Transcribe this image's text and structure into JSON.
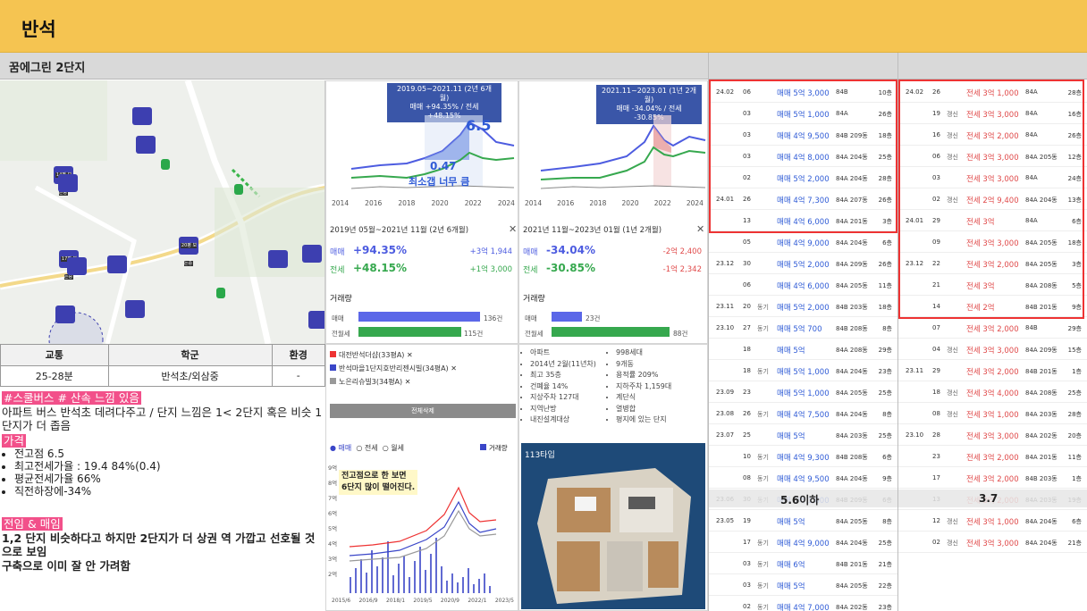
{
  "header": {
    "title": "반석"
  },
  "complex": {
    "name": "꿈에그린 2단지"
  },
  "map": {
    "labels": [
      "17평 보는중",
      "14평 보는중",
      "20평 보는중"
    ]
  },
  "chart_left": {
    "caption_line1": "2019.05~2021.11 (2년 6개월)",
    "caption_line2": "매매 +94.35% / 전세 +48.15%",
    "annotation_big": "6.5",
    "annotation_small": "0.47",
    "annotation_text": "최소갭 너무 큼",
    "summary_period": "2019년 05월~2021년 11월 (2년 6개월)",
    "sale_label": "매매",
    "sale_pct": "+94.35%",
    "sale_amt": "+3억 1,944",
    "rent_label": "전세",
    "rent_pct": "+48.15%",
    "rent_amt": "+1억 3,000",
    "volume_label": "거래량",
    "vol_sale_label": "매매",
    "vol_sale": "136건",
    "vol_rent_label": "전월세",
    "vol_rent": "115건",
    "x_ticks": [
      "2014",
      "2016",
      "2018",
      "2020",
      "2022",
      "2024"
    ]
  },
  "chart_right": {
    "caption_line1": "2021.11~2023.01 (1년 2개월)",
    "caption_line2": "매매 -34.04% / 전세 -30.85%",
    "summary_period": "2021년 11월~2023년 01월 (1년 2개월)",
    "sale_label": "매매",
    "sale_pct": "-34.04%",
    "sale_amt": "-2억 2,400",
    "rent_label": "전세",
    "rent_pct": "-30.85%",
    "rent_amt": "-1억 2,342",
    "volume_label": "거래량",
    "vol_sale_label": "매매",
    "vol_sale": "23건",
    "vol_rent_label": "전월세",
    "vol_rent": "88건",
    "x_ticks": [
      "2014",
      "2016",
      "2018",
      "2020",
      "2022",
      "2024"
    ]
  },
  "info_table": {
    "headers": [
      "교통",
      "학군",
      "환경"
    ],
    "values": [
      "25-28분",
      "반석초/외삼중",
      "-"
    ]
  },
  "notes": {
    "tag1": "#스쿨버스 # 산속 느낌 있음",
    "line1": "아파트 버스 반석초 데려다주고 / 단지 느낌은 1< 2단지 혹은 비슷 1단지가 더 좁음",
    "tag2": "가격",
    "bullets": [
      "전고점 6.5",
      "최고전세가율 : 19.4 84%(0.4)",
      "평균전세가율 66%",
      "직전하장에-34%"
    ],
    "tag3": "전임 & 매임",
    "line2": "1,2 단지 비슷하다고 하지만 2단지가 더 상권 역 가깝고 선호될 것으로 보임",
    "line3": "구축으로 이미 잘 안 가려함"
  },
  "compare": {
    "items": [
      "대전반석더샵(33평A)",
      "반석마을1단지호반리젠시빌(34평A)",
      "노은리슈빌3(34평A)"
    ],
    "button": "전체삭제",
    "radios": [
      "매매",
      "전세",
      "월세"
    ],
    "legend": "거래량",
    "annotation_line1": "전고점으로 한 보면",
    "annotation_line2": "6단지 많이 떨어진다.",
    "x_ticks": [
      "2015/6",
      "2016/9",
      "2018/1",
      "2019/5",
      "2020/9",
      "2022/1",
      "2023/5"
    ],
    "y_ticks": [
      "9억",
      "8억",
      "7억",
      "6억",
      "5억",
      "4억",
      "3억",
      "2억",
      "1억"
    ]
  },
  "facts": {
    "left": [
      "아파트",
      "2014년 2월(11년차)",
      "최고 35층",
      "건폐율 14%",
      "지상주차 127대",
      "지역난방",
      "내진설계대상"
    ],
    "right": [
      "998세대",
      "9개동",
      "용적률 209%",
      "지하주차 1,159대",
      "계단식",
      "열병합",
      "평지에 있는 단지"
    ],
    "floorplan_label": "113타입"
  },
  "sales_table": {
    "note": "5.6이하",
    "rows": [
      {
        "m": "24.02",
        "d": "06",
        "k": "",
        "p": "매매 5억 3,000",
        "t": "84B",
        "f": "10층"
      },
      {
        "m": "",
        "d": "03",
        "k": "",
        "p": "매매 5억 1,000",
        "t": "84A",
        "f": "26층"
      },
      {
        "m": "",
        "d": "03",
        "k": "",
        "p": "매매 4억 9,500",
        "t": "84B 209동",
        "f": "18층"
      },
      {
        "m": "",
        "d": "03",
        "k": "",
        "p": "매매 4억 8,000",
        "t": "84A 204동",
        "f": "25층"
      },
      {
        "m": "",
        "d": "02",
        "k": "",
        "p": "매매 5억 2,000",
        "t": "84A 204동",
        "f": "28층"
      },
      {
        "m": "24.01",
        "d": "26",
        "k": "",
        "p": "매매 4억 7,300",
        "t": "84A 207동",
        "f": "26층"
      },
      {
        "m": "",
        "d": "13",
        "k": "",
        "p": "매매 4억 6,000",
        "t": "84A 201동",
        "f": "3층"
      },
      {
        "m": "",
        "d": "05",
        "k": "",
        "p": "매매 4억 9,000",
        "t": "84A 204동",
        "f": "6층"
      },
      {
        "m": "23.12",
        "d": "30",
        "k": "",
        "p": "매매 5억 2,000",
        "t": "84A 209동",
        "f": "26층"
      },
      {
        "m": "",
        "d": "06",
        "k": "",
        "p": "매매 4억 6,000",
        "t": "84A 205동",
        "f": "11층"
      },
      {
        "m": "23.11",
        "d": "20",
        "k": "동기",
        "p": "매매 5억 2,000",
        "t": "84B 203동",
        "f": "18층"
      },
      {
        "m": "23.10",
        "d": "27",
        "k": "동기",
        "p": "매매 5억 700",
        "t": "84B 208동",
        "f": "8층"
      },
      {
        "m": "",
        "d": "18",
        "k": "",
        "p": "매매 5억",
        "t": "84A 208동",
        "f": "29층"
      },
      {
        "m": "",
        "d": "18",
        "k": "동기",
        "p": "매매 5억 1,000",
        "t": "84A 204동",
        "f": "23층"
      },
      {
        "m": "23.09",
        "d": "23",
        "k": "",
        "p": "매매 5억 1,000",
        "t": "84A 205동",
        "f": "25층"
      },
      {
        "m": "23.08",
        "d": "26",
        "k": "동기",
        "p": "매매 4억 7,500",
        "t": "84A 204동",
        "f": "8층"
      },
      {
        "m": "23.07",
        "d": "25",
        "k": "",
        "p": "매매 5억",
        "t": "84A 203동",
        "f": "25층"
      },
      {
        "m": "",
        "d": "10",
        "k": "동기",
        "p": "매매 4억 9,300",
        "t": "84B 208동",
        "f": "6층"
      },
      {
        "m": "",
        "d": "08",
        "k": "동기",
        "p": "매매 4억 9,500",
        "t": "84A 204동",
        "f": "9층"
      },
      {
        "m": "23.06",
        "d": "30",
        "k": "동기",
        "p": "매매 5억 1,800",
        "t": "84B 209동",
        "f": "6층"
      },
      {
        "m": "23.05",
        "d": "19",
        "k": "",
        "p": "매매 5억",
        "t": "84A 205동",
        "f": "8층"
      },
      {
        "m": "",
        "d": "17",
        "k": "동기",
        "p": "매매 4억 9,000",
        "t": "84A 204동",
        "f": "25층"
      },
      {
        "m": "",
        "d": "03",
        "k": "동기",
        "p": "매매 6억",
        "t": "84B 201동",
        "f": "21층"
      },
      {
        "m": "",
        "d": "03",
        "k": "동기",
        "p": "매매 5억",
        "t": "84A 205동",
        "f": "22층"
      },
      {
        "m": "",
        "d": "02",
        "k": "동기",
        "p": "매매 4억 7,000",
        "t": "84A 202동",
        "f": "23층"
      }
    ]
  },
  "rent_table": {
    "note": "3.7",
    "rows": [
      {
        "m": "24.02",
        "d": "26",
        "k": "",
        "p": "전세 3억 1,000",
        "t": "84A",
        "f": "28층"
      },
      {
        "m": "",
        "d": "19",
        "k": "갱신",
        "p": "전세 3억 3,000",
        "t": "84A",
        "f": "16층"
      },
      {
        "m": "",
        "d": "16",
        "k": "갱신",
        "p": "전세 3억 2,000",
        "t": "84A",
        "f": "26층"
      },
      {
        "m": "",
        "d": "06",
        "k": "갱신",
        "p": "전세 3억 3,000",
        "t": "84A 205동",
        "f": "12층"
      },
      {
        "m": "",
        "d": "03",
        "k": "",
        "p": "전세 3억 3,000",
        "t": "84A",
        "f": "24층"
      },
      {
        "m": "",
        "d": "02",
        "k": "갱신",
        "p": "전세 2억 9,400",
        "t": "84A 204동",
        "f": "13층"
      },
      {
        "m": "24.01",
        "d": "29",
        "k": "",
        "p": "전세 3억",
        "t": "84A",
        "f": "6층"
      },
      {
        "m": "",
        "d": "09",
        "k": "",
        "p": "전세 3억 3,000",
        "t": "84A 205동",
        "f": "18층"
      },
      {
        "m": "23.12",
        "d": "22",
        "k": "",
        "p": "전세 3억 2,000",
        "t": "84A 205동",
        "f": "3층"
      },
      {
        "m": "",
        "d": "21",
        "k": "",
        "p": "전세 3억",
        "t": "84A 208동",
        "f": "5층"
      },
      {
        "m": "",
        "d": "14",
        "k": "",
        "p": "전세 2억",
        "t": "84B 201동",
        "f": "9층"
      },
      {
        "m": "",
        "d": "07",
        "k": "",
        "p": "전세 3억 2,000",
        "t": "84B",
        "f": "29층"
      },
      {
        "m": "",
        "d": "04",
        "k": "갱신",
        "p": "전세 3억 3,000",
        "t": "84A 209동",
        "f": "15층"
      },
      {
        "m": "23.11",
        "d": "29",
        "k": "",
        "p": "전세 3억 2,000",
        "t": "84B 201동",
        "f": "1층"
      },
      {
        "m": "",
        "d": "18",
        "k": "갱신",
        "p": "전세 3억 4,000",
        "t": "84A 208동",
        "f": "25층"
      },
      {
        "m": "",
        "d": "08",
        "k": "갱신",
        "p": "전세 3억 1,000",
        "t": "84A 203동",
        "f": "28층"
      },
      {
        "m": "23.10",
        "d": "28",
        "k": "",
        "p": "전세 3억 3,000",
        "t": "84A 202동",
        "f": "20층"
      },
      {
        "m": "",
        "d": "23",
        "k": "",
        "p": "전세 3억 2,000",
        "t": "84A 201동",
        "f": "11층"
      },
      {
        "m": "",
        "d": "17",
        "k": "",
        "p": "전세 3억 2,000",
        "t": "84B 203동",
        "f": "1층"
      },
      {
        "m": "",
        "d": "13",
        "k": "",
        "p": "전세 3억 2,000",
        "t": "84A 203동",
        "f": "19층"
      },
      {
        "m": "",
        "d": "12",
        "k": "갱신",
        "p": "전세 3억 1,000",
        "t": "84A 204동",
        "f": "6층"
      },
      {
        "m": "",
        "d": "02",
        "k": "갱신",
        "p": "전세 3억 3,000",
        "t": "84A 204동",
        "f": "21층"
      }
    ]
  }
}
